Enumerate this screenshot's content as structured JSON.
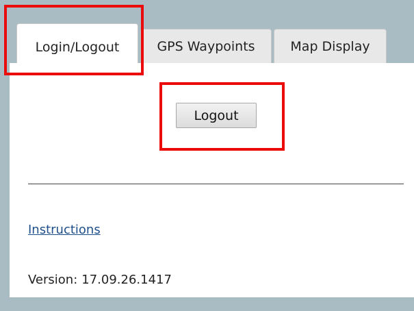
{
  "tabs": [
    {
      "label": "Login/Logout",
      "active": true
    },
    {
      "label": "GPS Waypoints",
      "active": false
    },
    {
      "label": "Map Display",
      "active": false
    }
  ],
  "login": {
    "logout_label": "Logout"
  },
  "footer": {
    "instructions_label": "Instructions",
    "version_label": "Version:",
    "version_value": "17.09.26.1417"
  },
  "colors": {
    "background": "#a9bcc4",
    "highlight": "#ec0b0b",
    "link": "#1f4f8a"
  }
}
